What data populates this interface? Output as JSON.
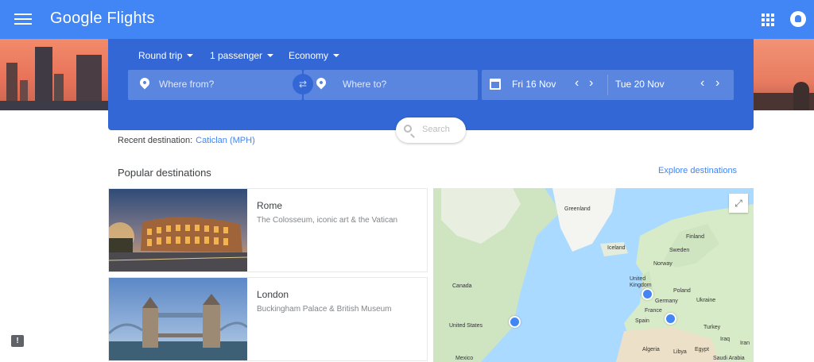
{
  "app": {
    "title": "Google Flights",
    "brand_color": "#4285f4",
    "panel_color": "#3367d6"
  },
  "header": {
    "menu_icon": "hamburger-menu-icon",
    "apps_icon": "apps-grid-icon",
    "account_icon": "account-icon"
  },
  "search": {
    "trip_type": "Round trip",
    "passengers": "1 passenger",
    "cabin": "Economy",
    "from_placeholder": "Where from?",
    "to_placeholder": "Where to?",
    "depart_date": "Fri 16 Nov",
    "return_date": "Tue 20 Nov",
    "prev_symbol": "‹",
    "next_symbol": "›",
    "swap_symbol": "⇄",
    "search_label": "Search"
  },
  "recent": {
    "label": "Recent destination:",
    "destination": "Caticlan (MPH)"
  },
  "popular": {
    "title": "Popular destinations",
    "explore_label": "Explore destinations",
    "items": [
      {
        "name": "Rome",
        "description": "The Colosseum, iconic art & the Vatican"
      },
      {
        "name": "London",
        "description": "Buckingham Palace & British Museum"
      }
    ]
  },
  "map": {
    "expand_symbol": "⤢",
    "labels": {
      "greenland": "Greenland",
      "iceland": "Iceland",
      "finland": "Finland",
      "sweden": "Sweden",
      "norway": "Norway",
      "canada": "Canada",
      "united_kingdom": "United Kingdom",
      "poland": "Poland",
      "germany": "Germany",
      "ukraine": "Ukraine",
      "france": "France",
      "united_states": "United States",
      "spain": "Spain",
      "turkey": "Turkey",
      "iraq": "Iraq",
      "algeria": "Algeria",
      "libya": "Libya",
      "egypt": "Egypt",
      "iran": "Iran",
      "mexico": "Mexico",
      "saudi_arabia": "Saudi Arabia"
    }
  },
  "feedback": {
    "symbol": "!"
  }
}
